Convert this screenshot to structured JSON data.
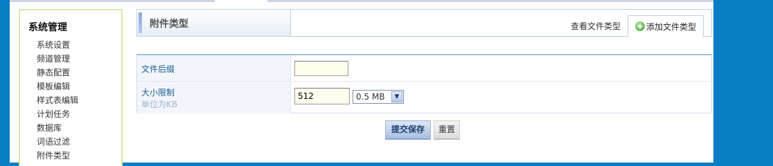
{
  "sidebar": {
    "title": "系统管理",
    "items": [
      {
        "label": "系统设置"
      },
      {
        "label": "频道管理"
      },
      {
        "label": "静态配置"
      },
      {
        "label": "模板编辑"
      },
      {
        "label": "样式表编辑"
      },
      {
        "label": "计划任务"
      },
      {
        "label": "数据库"
      },
      {
        "label": "词语过滤"
      },
      {
        "label": "附件类型"
      }
    ]
  },
  "header": {
    "title": "附件类型",
    "view_link": "查看文件类型",
    "add_tab": "添加文件类型"
  },
  "form": {
    "ext_label": "文件后缀",
    "ext_value": "",
    "size_label": "大小限制",
    "size_hint": "单位为KB",
    "size_value": "512",
    "size_select_value": "0.5 MB"
  },
  "buttons": {
    "submit": "提交保存",
    "reset": "重置"
  },
  "colors": {
    "background": "#0a7ec4",
    "sidebar_border": "#d6e9a8",
    "label_text": "#1d5b8f"
  }
}
